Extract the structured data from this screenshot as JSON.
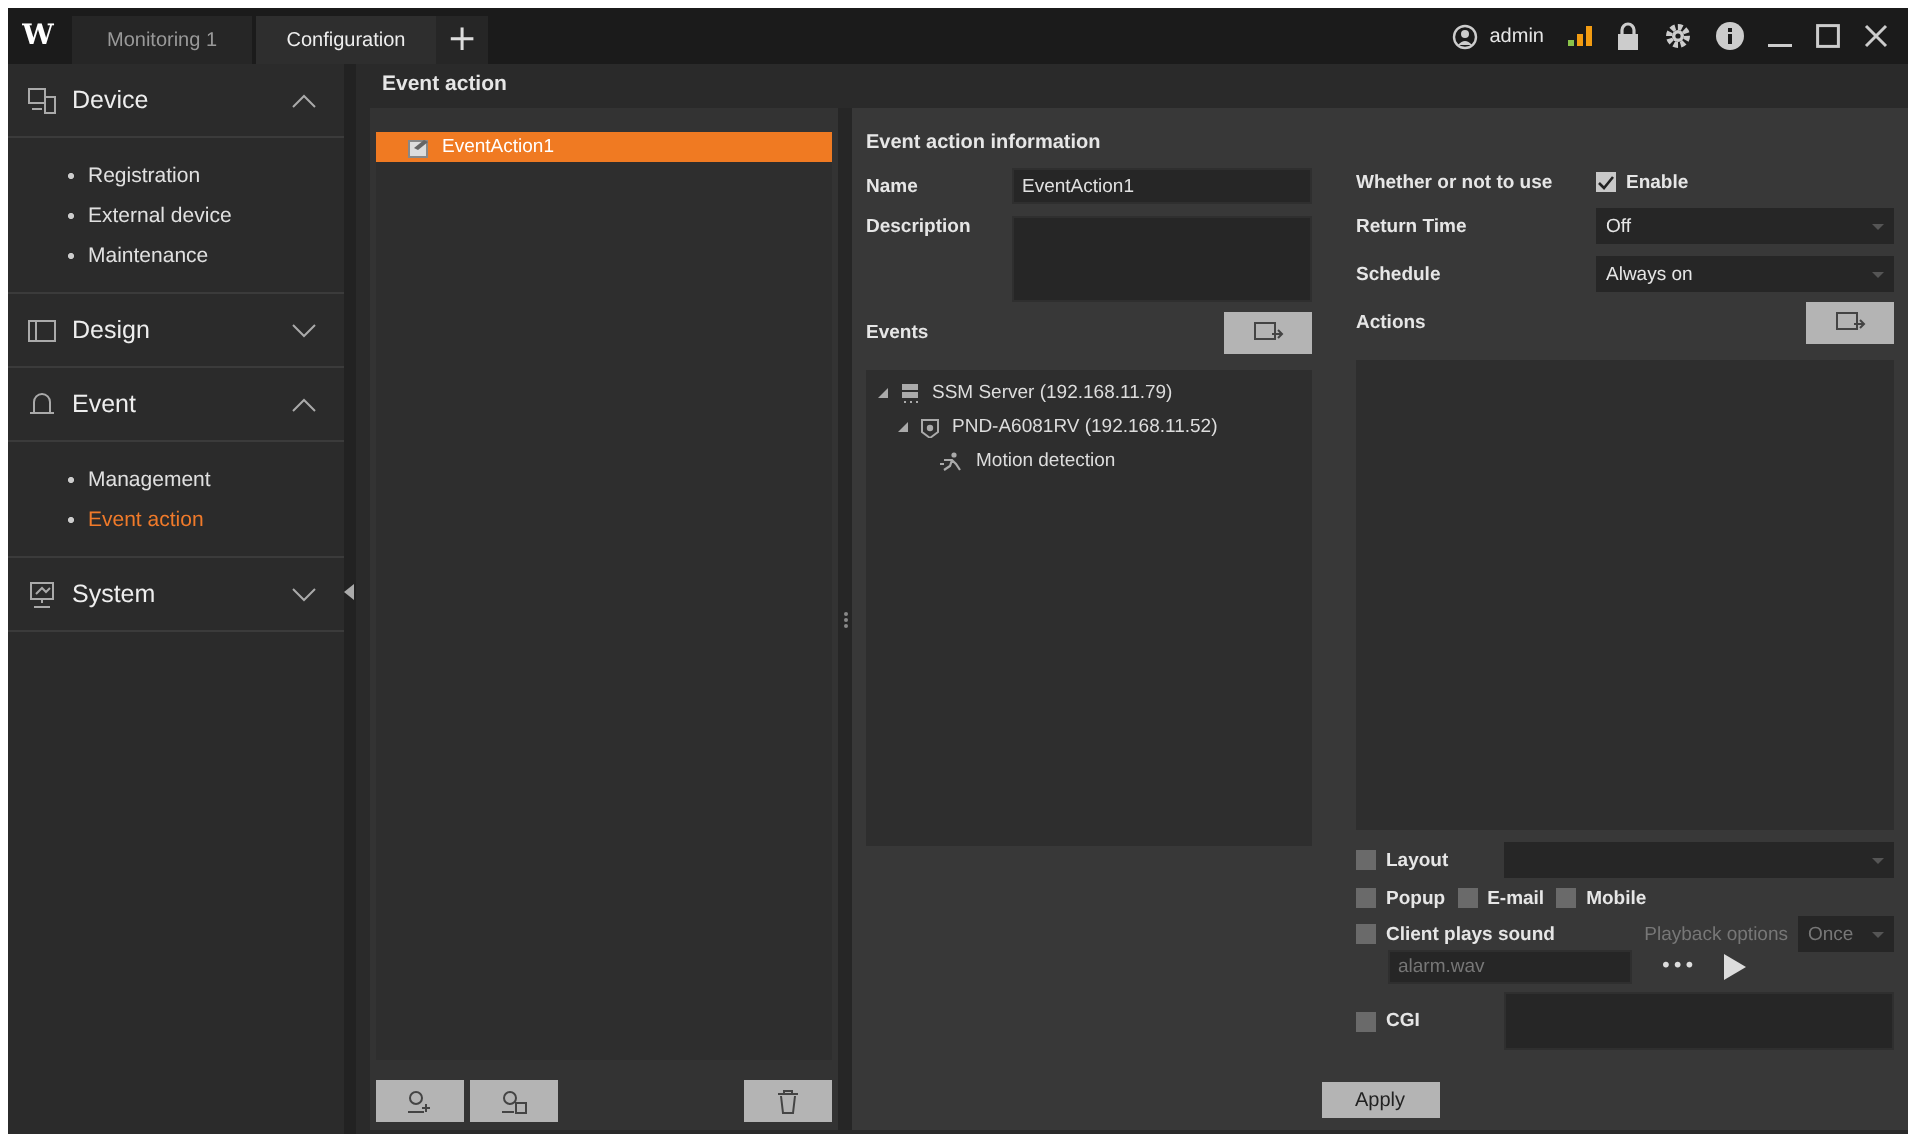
{
  "title_bar": {
    "logo": "W",
    "tabs": [
      {
        "label": "Monitoring 1",
        "selected": false
      },
      {
        "label": "Configuration",
        "selected": true
      }
    ],
    "add_tab": "+",
    "user": "admin"
  },
  "sidebar": {
    "sections": [
      {
        "label": "Device",
        "kind": "device",
        "expanded": true,
        "items": [
          {
            "label": "Registration",
            "selected": false
          },
          {
            "label": "External device",
            "selected": false
          },
          {
            "label": "Maintenance",
            "selected": false
          }
        ]
      },
      {
        "label": "Design",
        "kind": "design",
        "expanded": false
      },
      {
        "label": "Event",
        "kind": "event",
        "expanded": true,
        "items": [
          {
            "label": "Management",
            "selected": false
          },
          {
            "label": "Event action",
            "selected": true
          }
        ]
      },
      {
        "label": "System",
        "kind": "system",
        "expanded": false
      }
    ]
  },
  "page_title": "Event action",
  "event_actions": [
    {
      "label": "EventAction1",
      "selected": true
    }
  ],
  "info": {
    "heading": "Event action information",
    "name_label": "Name",
    "name_value": "EventAction1",
    "description_label": "Description",
    "use_label": "Whether or not to use",
    "enable": {
      "label": "Enable",
      "checked": true
    },
    "return_time": {
      "label": "Return Time",
      "value": "Off"
    },
    "schedule": {
      "label": "Schedule",
      "value": "Always on"
    },
    "events_label": "Events",
    "actions_label": "Actions"
  },
  "events_tree": [
    {
      "label": "SSM Server (192.168.11.79)",
      "kind": "server",
      "expanded": true,
      "children": [
        {
          "label": "PND-A6081RV (192.168.11.52)",
          "kind": "camera",
          "expanded": true,
          "children": [
            {
              "label": "Motion detection",
              "kind": "motion"
            }
          ]
        }
      ]
    }
  ],
  "options": {
    "layout": {
      "label": "Layout",
      "checked": false
    },
    "popup": {
      "label": "Popup",
      "checked": false
    },
    "email": {
      "label": "E-mail",
      "checked": false
    },
    "mobile": {
      "label": "Mobile",
      "checked": false
    },
    "sound": {
      "label": "Client plays sound",
      "checked": false
    },
    "playback_label": "Playback options",
    "playback_value": "Once",
    "sound_file": "alarm.wav",
    "browse": "•••",
    "cgi": {
      "label": "CGI",
      "checked": false
    }
  },
  "apply": "Apply"
}
